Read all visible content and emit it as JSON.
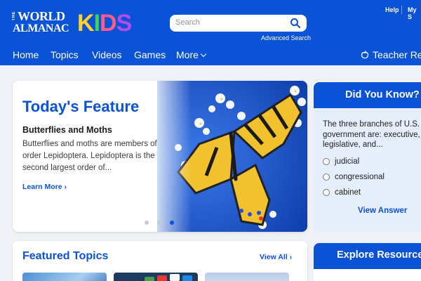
{
  "header": {
    "logo": {
      "the": "THE",
      "line1": "WORLD",
      "line2": "ALMANAC",
      "kids": [
        "K",
        "I",
        "D",
        "S"
      ]
    },
    "search_placeholder": "Search",
    "advanced_search": "Advanced Search",
    "help": "Help",
    "my_s": "My S",
    "nav": {
      "home": "Home",
      "topics": "Topics",
      "videos": "Videos",
      "games": "Games",
      "more": "More"
    },
    "teacher": "Teacher Res"
  },
  "feature": {
    "title": "Today's Feature",
    "subtitle": "Butterflies and Moths",
    "description": "Butterflies and moths are members of order Lepidoptera. Lepidoptera is the second largest order of...",
    "learn_more": "Learn More",
    "carousel_active_index": 3,
    "carousel_count": 3
  },
  "did_you_know": {
    "title": "Did You Know?",
    "question": "The three branches of U.S. government are: executive, legislative, and...",
    "options": [
      "judicial",
      "congressional",
      "cabinet"
    ],
    "view_answer": "View Answer"
  },
  "featured_topics": {
    "title": "Featured Topics",
    "view_all": "View All"
  },
  "explore": {
    "title": "Explore Resource"
  },
  "colors": {
    "brand_blue": "#0a52d6",
    "background": "#eef1f6"
  },
  "icons": [
    "search-icon",
    "chevron-down-icon",
    "chevron-right-icon",
    "apple-icon"
  ]
}
